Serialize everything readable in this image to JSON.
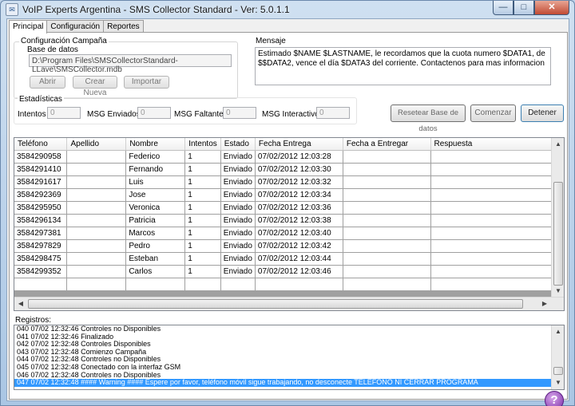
{
  "window": {
    "title": "VoIP Experts Argentina - SMS Collector Standard - Ver: 5.0.1.1",
    "minimize_glyph": "—",
    "maximize_glyph": "□",
    "close_glyph": "✕"
  },
  "tabs": [
    "Principal",
    "Configuración",
    "Reportes"
  ],
  "campaign": {
    "group_title": "Configuración Campaña",
    "db_label": "Base de datos",
    "db_path": "D:\\Program Files\\SMSCollectorStandard- LLave\\SMSCollector.mdb",
    "btn_open": "Abrir",
    "btn_new": "Crear Nueva",
    "btn_import": "Importar"
  },
  "message": {
    "title": "Mensaje",
    "text": "Estimado $NAME $LASTNAME, le recordamos que la cuota numero $DATA1, de $$DATA2, vence el día $DATA3 del corriente. Contactenos para mas informacion"
  },
  "stats": {
    "title": "Estadísticas",
    "intentos_label": "Intentos",
    "intentos_value": "0",
    "enviados_label": "MSG Enviados:",
    "enviados_value": "0",
    "faltantes_label": "MSG Faltantes:",
    "faltantes_value": "0",
    "interactivos_label": "MSG Interactivos:",
    "interactivos_value": "0"
  },
  "actions": {
    "reset": "Resetear Base de datos",
    "start": "Comenzar",
    "stop": "Detener"
  },
  "grid": {
    "columns": [
      "Teléfono",
      "Apellido",
      "Nombre",
      "Intentos",
      "Estado",
      "Fecha Entrega",
      "Fecha a Entregar",
      "Respuesta"
    ],
    "rows": [
      [
        "3584290958",
        "",
        "Federico",
        "1",
        "Enviado",
        "07/02/2012 12:03:28",
        "",
        ""
      ],
      [
        "3584291410",
        "",
        "Fernando",
        "1",
        "Enviado",
        "07/02/2012 12:03:30",
        "",
        ""
      ],
      [
        "3584291617",
        "",
        "Luis",
        "1",
        "Enviado",
        "07/02/2012 12:03:32",
        "",
        ""
      ],
      [
        "3584292369",
        "",
        "Jose",
        "1",
        "Enviado",
        "07/02/2012 12:03:34",
        "",
        ""
      ],
      [
        "3584295950",
        "",
        "Veronica",
        "1",
        "Enviado",
        "07/02/2012 12:03:36",
        "",
        ""
      ],
      [
        "3584296134",
        "",
        "Patricia",
        "1",
        "Enviado",
        "07/02/2012 12:03:38",
        "",
        ""
      ],
      [
        "3584297381",
        "",
        "Marcos",
        "1",
        "Enviado",
        "07/02/2012 12:03:40",
        "",
        ""
      ],
      [
        "3584297829",
        "",
        "Pedro",
        "1",
        "Enviado",
        "07/02/2012 12:03:42",
        "",
        ""
      ],
      [
        "3584298475",
        "",
        "Esteban",
        "1",
        "Enviado",
        "07/02/2012 12:03:44",
        "",
        ""
      ],
      [
        "3584299352",
        "",
        "Carlos",
        "1",
        "Enviado",
        "07/02/2012 12:03:46",
        "",
        ""
      ],
      [
        "",
        "",
        "",
        "",
        "",
        "",
        "",
        ""
      ]
    ]
  },
  "log": {
    "title": "Registros:",
    "lines": [
      "040 07/02 12:32:46 Controles no Disponibles",
      "041 07/02 12:32:46 Finalizado",
      "042 07/02 12:32:48 Controles Disponibles",
      "043 07/02 12:32:48 Comienzo Campaña",
      "044 07/02 12:32:48 Controles no Disponibles",
      "045 07/02 12:32:48 Conectado con la interfaz GSM",
      "046 07/02 12:32:48 Controles no Disponibles",
      "047 07/02 12:32:48 #### Warning #### Espere por favor, teléfono móvil sigue trabajando, no desconecte TELEFONO NI CERRAR PROGRAMA"
    ],
    "selected_index": 7
  },
  "help_glyph": "?",
  "colors": {
    "selection": "#3399ff",
    "help_button": "#7b2ea8"
  }
}
